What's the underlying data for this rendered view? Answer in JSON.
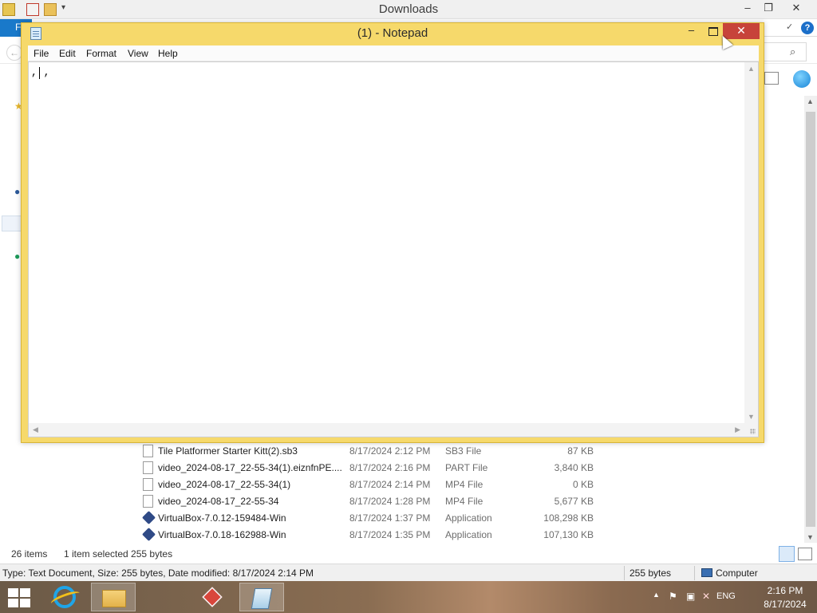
{
  "explorer": {
    "title": "Downloads",
    "file_tab": "F",
    "help_label": "?",
    "window_controls": {
      "minimize": "–",
      "maximize": "❐",
      "close": "✕"
    },
    "files": [
      {
        "name": "Tile Platformer Starter Kitt(2).sb3",
        "date": "8/17/2024 2:12 PM",
        "type": "SB3 File",
        "size": "87 KB",
        "icon": "document-icon"
      },
      {
        "name": "video_2024-08-17_22-55-34(1).eiznfnPE....",
        "date": "8/17/2024 2:16 PM",
        "type": "PART File",
        "size": "3,840 KB",
        "icon": "document-icon"
      },
      {
        "name": "video_2024-08-17_22-55-34(1)",
        "date": "8/17/2024 2:14 PM",
        "type": "MP4 File",
        "size": "0 KB",
        "icon": "document-icon"
      },
      {
        "name": "video_2024-08-17_22-55-34",
        "date": "8/17/2024 1:28 PM",
        "type": "MP4 File",
        "size": "5,677 KB",
        "icon": "document-icon"
      },
      {
        "name": "VirtualBox-7.0.12-159484-Win",
        "date": "8/17/2024 1:37 PM",
        "type": "Application",
        "size": "108,298 KB",
        "icon": "virtualbox-icon"
      },
      {
        "name": "VirtualBox-7.0.18-162988-Win",
        "date": "8/17/2024 1:35 PM",
        "type": "Application",
        "size": "107,130 KB",
        "icon": "virtualbox-icon"
      }
    ],
    "status": {
      "items": "26 items",
      "selected": "1 item selected  255 bytes"
    },
    "bottombar": {
      "type_info": "Type: Text Document, Size: 255 bytes, Date modified: 8/17/2024 2:14 PM",
      "size": "255 bytes",
      "location": "Computer"
    }
  },
  "notepad": {
    "title": "(1) - Notepad",
    "menu": [
      "File",
      "Edit",
      "Format",
      "View",
      "Help"
    ],
    "content": ", ,",
    "window_controls": {
      "minimize": "–",
      "close": "✕"
    }
  },
  "taskbar": {
    "apps": [
      {
        "name": "internet-explorer",
        "active": false
      },
      {
        "name": "file-explorer",
        "active": true
      },
      {
        "name": "red-cube-app",
        "active": false
      },
      {
        "name": "notepad",
        "active": true
      }
    ],
    "tray": {
      "language": "ENG",
      "time": "2:16 PM",
      "date": "8/17/2024"
    }
  },
  "colors": {
    "notepad_frame": "#f6d96b",
    "close_button": "#c7433a",
    "file_tab": "#1979ca"
  }
}
